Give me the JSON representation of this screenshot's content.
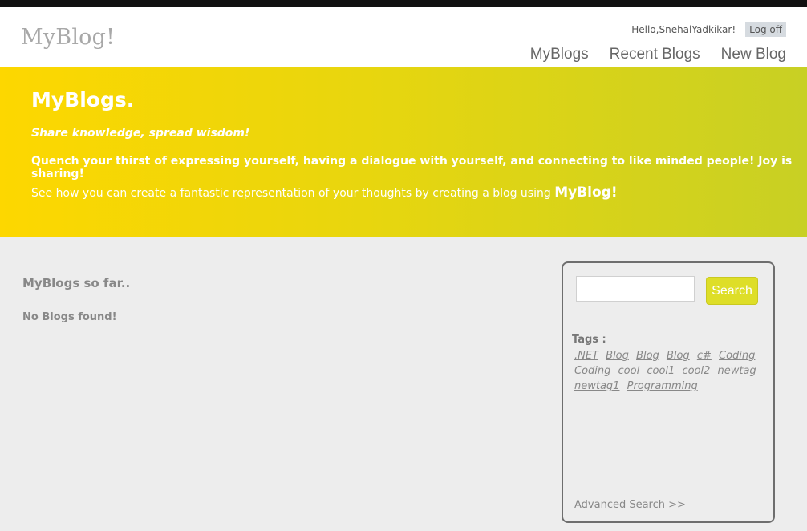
{
  "header": {
    "logo": "MyBlog!",
    "greeting": "Hello, ",
    "username": "SnehalYadkikar",
    "greeting_end": "!",
    "logoff": "Log off",
    "nav": [
      "MyBlogs",
      "Recent Blogs",
      "New Blog"
    ]
  },
  "banner": {
    "title": "MyBlogs.",
    "tagline": "Share knowledge, spread wisdom!",
    "quench": "Quench your thirst of expressing yourself, having a dialogue with yourself, and connecting to like minded people! Joy is sharing!",
    "seehow": "See how you can create a fantastic representation of your thoughts by creating a blog using ",
    "brand": "MyBlog!"
  },
  "main": {
    "title": "MyBlogs so far..",
    "empty": "No Blogs found!"
  },
  "sidebar": {
    "search_value": "",
    "search_button": "Search",
    "tags_label": "Tags :",
    "tags": [
      ".NET",
      "Blog",
      "Blog",
      "Blog",
      "c#",
      "Coding",
      "Coding",
      "cool",
      "cool1",
      "cool2",
      "newtag",
      "newtag1",
      "Programming"
    ],
    "advanced": "Advanced Search >>"
  },
  "colors": {
    "banner_start": "#fdd700",
    "banner_end": "#c8d024",
    "search_button": "#dede28"
  }
}
